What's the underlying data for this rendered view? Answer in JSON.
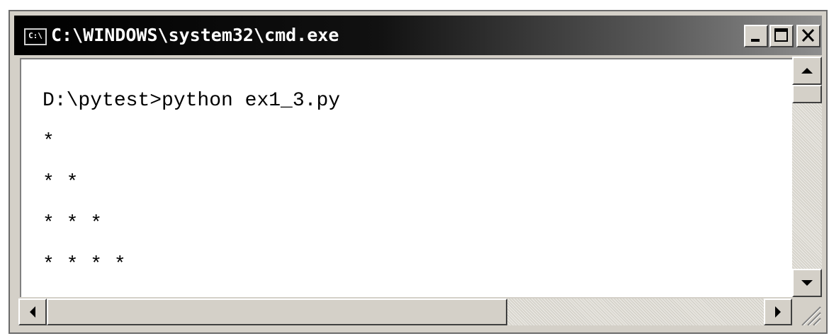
{
  "window": {
    "title": "C:\\WINDOWS\\system32\\cmd.exe",
    "icon_label": "C:\\",
    "controls": [
      "minimize",
      "maximize",
      "close"
    ]
  },
  "console": {
    "lines": [
      "D:\\pytest>python ex1_3.py",
      "*",
      "* *",
      "* * *",
      "* * * *"
    ]
  },
  "icons": {
    "app": "cmd-icon",
    "minimize": "minimize-icon",
    "maximize": "maximize-icon",
    "close": "close-icon",
    "scroll_up": "arrow-up-icon",
    "scroll_down": "arrow-down-icon",
    "scroll_left": "arrow-left-icon",
    "scroll_right": "arrow-right-icon",
    "resize": "resize-grip-icon"
  },
  "colors": {
    "titlebar": "#000000",
    "face": "#d4d0c8",
    "console_bg": "#ffffff",
    "console_text": "#000000"
  }
}
